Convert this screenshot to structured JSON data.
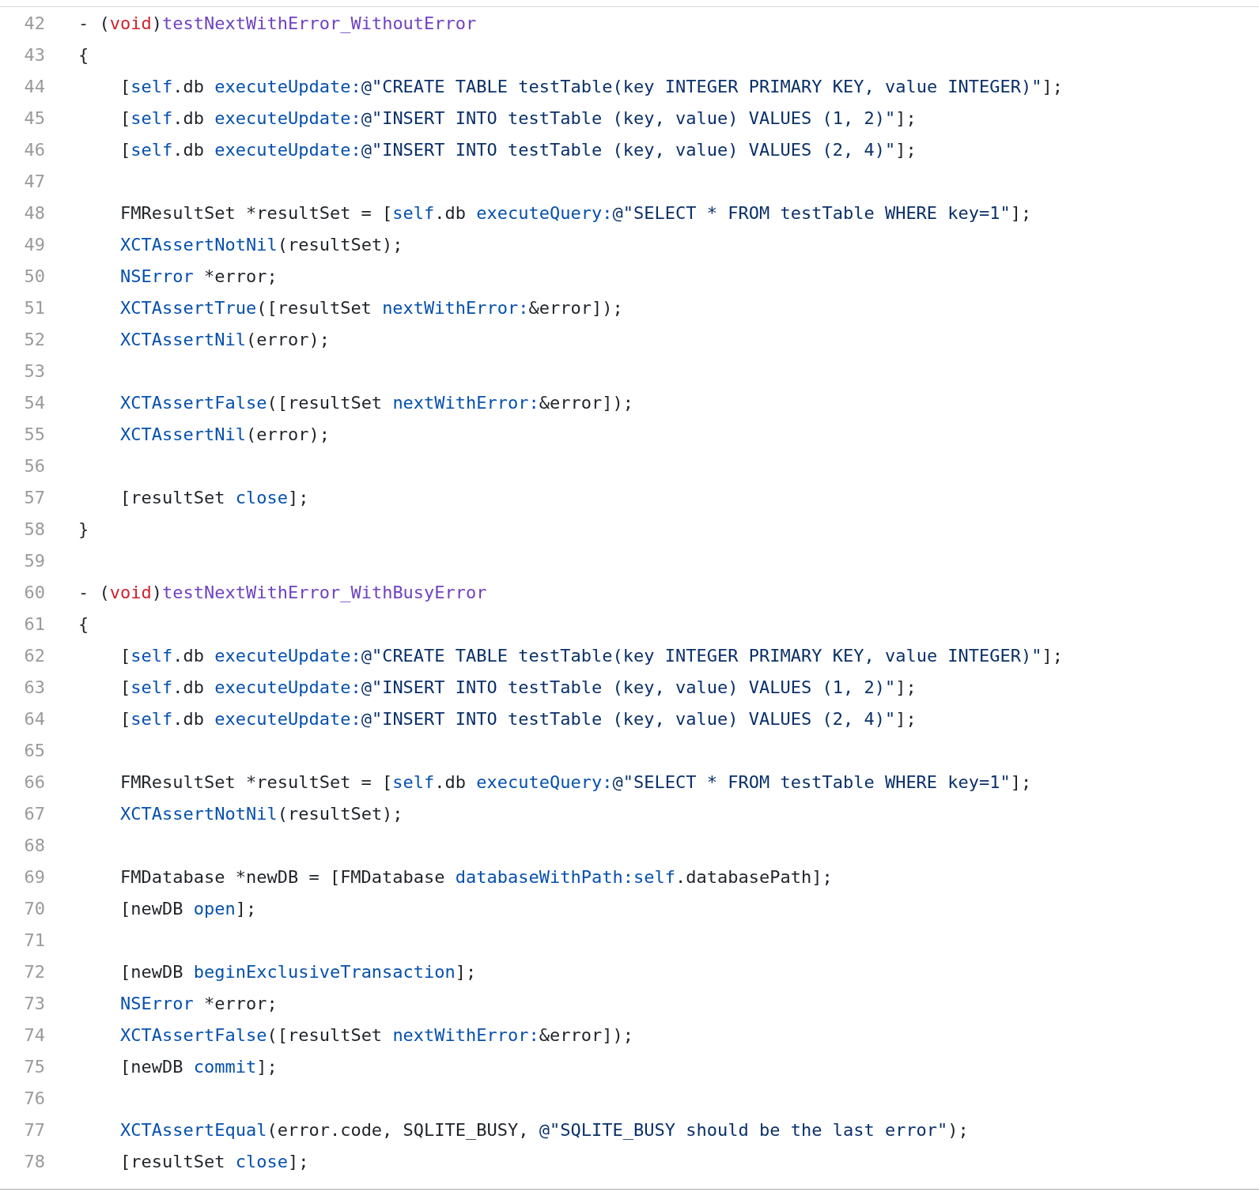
{
  "lines": [
    {
      "number": "42",
      "tokens": [
        {
          "kind": "plain",
          "text": "- ("
        },
        {
          "kind": "keyword",
          "text": "void"
        },
        {
          "kind": "plain",
          "text": ")"
        },
        {
          "kind": "method",
          "text": "testNextWithError_WithoutError"
        }
      ]
    },
    {
      "number": "43",
      "tokens": [
        {
          "kind": "plain",
          "text": "{"
        }
      ]
    },
    {
      "number": "44",
      "tokens": [
        {
          "kind": "plain",
          "text": "    ["
        },
        {
          "kind": "symbol",
          "text": "self"
        },
        {
          "kind": "plain",
          "text": ".db "
        },
        {
          "kind": "symbol",
          "text": "executeUpdate:"
        },
        {
          "kind": "string",
          "text": "@\"CREATE TABLE testTable(key INTEGER PRIMARY KEY, value INTEGER)\""
        },
        {
          "kind": "plain",
          "text": "];"
        }
      ]
    },
    {
      "number": "45",
      "tokens": [
        {
          "kind": "plain",
          "text": "    ["
        },
        {
          "kind": "symbol",
          "text": "self"
        },
        {
          "kind": "plain",
          "text": ".db "
        },
        {
          "kind": "symbol",
          "text": "executeUpdate:"
        },
        {
          "kind": "string",
          "text": "@\"INSERT INTO testTable (key, value) VALUES (1, 2)\""
        },
        {
          "kind": "plain",
          "text": "];"
        }
      ]
    },
    {
      "number": "46",
      "tokens": [
        {
          "kind": "plain",
          "text": "    ["
        },
        {
          "kind": "symbol",
          "text": "self"
        },
        {
          "kind": "plain",
          "text": ".db "
        },
        {
          "kind": "symbol",
          "text": "executeUpdate:"
        },
        {
          "kind": "string",
          "text": "@\"INSERT INTO testTable (key, value) VALUES (2, 4)\""
        },
        {
          "kind": "plain",
          "text": "];"
        }
      ]
    },
    {
      "number": "47"
    },
    {
      "number": "48",
      "tokens": [
        {
          "kind": "plain",
          "text": "    FMResultSet *resultSet = ["
        },
        {
          "kind": "symbol",
          "text": "self"
        },
        {
          "kind": "plain",
          "text": ".db "
        },
        {
          "kind": "symbol",
          "text": "executeQuery:"
        },
        {
          "kind": "string",
          "text": "@\"SELECT * FROM testTable WHERE key=1\""
        },
        {
          "kind": "plain",
          "text": "];"
        }
      ]
    },
    {
      "number": "49",
      "tokens": [
        {
          "kind": "symbol",
          "text": "    XCTAssertNotNil"
        },
        {
          "kind": "plain",
          "text": "(resultSet);"
        }
      ]
    },
    {
      "number": "50",
      "tokens": [
        {
          "kind": "symbol",
          "text": "    NSError"
        },
        {
          "kind": "plain",
          "text": " *error;"
        }
      ]
    },
    {
      "number": "51",
      "tokens": [
        {
          "kind": "symbol",
          "text": "    XCTAssertTrue"
        },
        {
          "kind": "plain",
          "text": "([resultSet "
        },
        {
          "kind": "symbol",
          "text": "nextWithError:"
        },
        {
          "kind": "plain",
          "text": "&error]);"
        }
      ]
    },
    {
      "number": "52",
      "tokens": [
        {
          "kind": "symbol",
          "text": "    XCTAssertNil"
        },
        {
          "kind": "plain",
          "text": "(error);"
        }
      ]
    },
    {
      "number": "53"
    },
    {
      "number": "54",
      "tokens": [
        {
          "kind": "symbol",
          "text": "    XCTAssertFalse"
        },
        {
          "kind": "plain",
          "text": "([resultSet "
        },
        {
          "kind": "symbol",
          "text": "nextWithError:"
        },
        {
          "kind": "plain",
          "text": "&error]);"
        }
      ]
    },
    {
      "number": "55",
      "tokens": [
        {
          "kind": "symbol",
          "text": "    XCTAssertNil"
        },
        {
          "kind": "plain",
          "text": "(error);"
        }
      ]
    },
    {
      "number": "56"
    },
    {
      "number": "57",
      "tokens": [
        {
          "kind": "plain",
          "text": "    [resultSet "
        },
        {
          "kind": "symbol",
          "text": "close"
        },
        {
          "kind": "plain",
          "text": "];"
        }
      ]
    },
    {
      "number": "58",
      "tokens": [
        {
          "kind": "plain",
          "text": "}"
        }
      ]
    },
    {
      "number": "59"
    },
    {
      "number": "60",
      "tokens": [
        {
          "kind": "plain",
          "text": "- ("
        },
        {
          "kind": "keyword",
          "text": "void"
        },
        {
          "kind": "plain",
          "text": ")"
        },
        {
          "kind": "method",
          "text": "testNextWithError_WithBusyError"
        }
      ]
    },
    {
      "number": "61",
      "tokens": [
        {
          "kind": "plain",
          "text": "{"
        }
      ]
    },
    {
      "number": "62",
      "tokens": [
        {
          "kind": "plain",
          "text": "    ["
        },
        {
          "kind": "symbol",
          "text": "self"
        },
        {
          "kind": "plain",
          "text": ".db "
        },
        {
          "kind": "symbol",
          "text": "executeUpdate:"
        },
        {
          "kind": "string",
          "text": "@\"CREATE TABLE testTable(key INTEGER PRIMARY KEY, value INTEGER)\""
        },
        {
          "kind": "plain",
          "text": "];"
        }
      ]
    },
    {
      "number": "63",
      "tokens": [
        {
          "kind": "plain",
          "text": "    ["
        },
        {
          "kind": "symbol",
          "text": "self"
        },
        {
          "kind": "plain",
          "text": ".db "
        },
        {
          "kind": "symbol",
          "text": "executeUpdate:"
        },
        {
          "kind": "string",
          "text": "@\"INSERT INTO testTable (key, value) VALUES (1, 2)\""
        },
        {
          "kind": "plain",
          "text": "];"
        }
      ]
    },
    {
      "number": "64",
      "tokens": [
        {
          "kind": "plain",
          "text": "    ["
        },
        {
          "kind": "symbol",
          "text": "self"
        },
        {
          "kind": "plain",
          "text": ".db "
        },
        {
          "kind": "symbol",
          "text": "executeUpdate:"
        },
        {
          "kind": "string",
          "text": "@\"INSERT INTO testTable (key, value) VALUES (2, 4)\""
        },
        {
          "kind": "plain",
          "text": "];"
        }
      ]
    },
    {
      "number": "65"
    },
    {
      "number": "66",
      "tokens": [
        {
          "kind": "plain",
          "text": "    FMResultSet *resultSet = ["
        },
        {
          "kind": "symbol",
          "text": "self"
        },
        {
          "kind": "plain",
          "text": ".db "
        },
        {
          "kind": "symbol",
          "text": "executeQuery:"
        },
        {
          "kind": "string",
          "text": "@\"SELECT * FROM testTable WHERE key=1\""
        },
        {
          "kind": "plain",
          "text": "];"
        }
      ]
    },
    {
      "number": "67",
      "tokens": [
        {
          "kind": "symbol",
          "text": "    XCTAssertNotNil"
        },
        {
          "kind": "plain",
          "text": "(resultSet);"
        }
      ]
    },
    {
      "number": "68"
    },
    {
      "number": "69",
      "tokens": [
        {
          "kind": "plain",
          "text": "    FMDatabase *newDB = [FMDatabase "
        },
        {
          "kind": "symbol",
          "text": "databaseWithPath:self"
        },
        {
          "kind": "plain",
          "text": ".databasePath];"
        }
      ]
    },
    {
      "number": "70",
      "tokens": [
        {
          "kind": "plain",
          "text": "    [newDB "
        },
        {
          "kind": "symbol",
          "text": "open"
        },
        {
          "kind": "plain",
          "text": "];"
        }
      ]
    },
    {
      "number": "71"
    },
    {
      "number": "72",
      "tokens": [
        {
          "kind": "plain",
          "text": "    [newDB "
        },
        {
          "kind": "symbol",
          "text": "beginExclusiveTransaction"
        },
        {
          "kind": "plain",
          "text": "];"
        }
      ]
    },
    {
      "number": "73",
      "tokens": [
        {
          "kind": "symbol",
          "text": "    NSError"
        },
        {
          "kind": "plain",
          "text": " *error;"
        }
      ]
    },
    {
      "number": "74",
      "tokens": [
        {
          "kind": "symbol",
          "text": "    XCTAssertFalse"
        },
        {
          "kind": "plain",
          "text": "([resultSet "
        },
        {
          "kind": "symbol",
          "text": "nextWithError:"
        },
        {
          "kind": "plain",
          "text": "&error]);"
        }
      ]
    },
    {
      "number": "75",
      "tokens": [
        {
          "kind": "plain",
          "text": "    [newDB "
        },
        {
          "kind": "symbol",
          "text": "commit"
        },
        {
          "kind": "plain",
          "text": "];"
        }
      ]
    },
    {
      "number": "76"
    },
    {
      "number": "77",
      "tokens": [
        {
          "kind": "symbol",
          "text": "    XCTAssertEqual"
        },
        {
          "kind": "plain",
          "text": "(error.code, SQLITE_BUSY, "
        },
        {
          "kind": "string",
          "text": "@\"SQLITE_BUSY should be the last error\""
        },
        {
          "kind": "plain",
          "text": ");"
        }
      ]
    },
    {
      "number": "78",
      "tokens": [
        {
          "kind": "plain",
          "text": "    [resultSet "
        },
        {
          "kind": "symbol",
          "text": "close"
        },
        {
          "kind": "plain",
          "text": "];"
        }
      ]
    }
  ]
}
